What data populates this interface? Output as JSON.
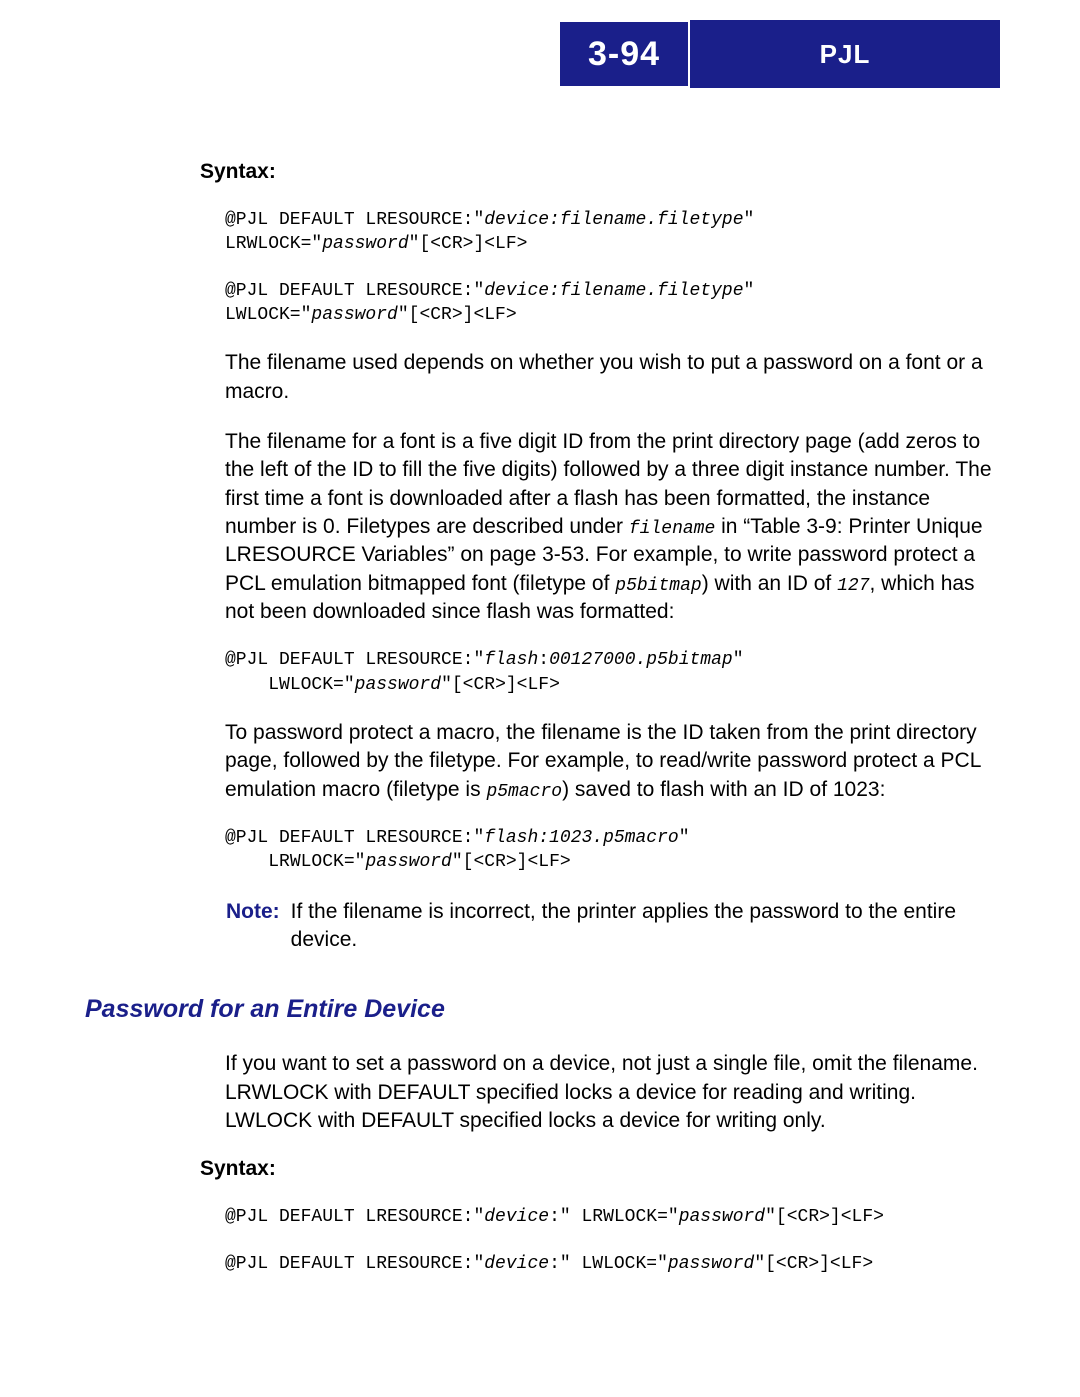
{
  "header": {
    "page_number": "3-94",
    "title": "PJL"
  },
  "section1": {
    "syntax_label": "Syntax:",
    "code1_pre": "@PJL DEFAULT LRESOURCE:\"",
    "code1_i1": "device:filename.filetype",
    "code1_mid": "\"\nLRWLOCK=\"",
    "code1_i2": "password",
    "code1_post": "\"[<CR>]<LF>",
    "code2_pre": "@PJL DEFAULT LRESOURCE:\"",
    "code2_i1": "device:filename.filetype",
    "code2_mid": "\"\nLWLOCK=\"",
    "code2_i2": "password",
    "code2_post": "\"[<CR>]<LF>",
    "para1": "The filename used depends on whether you wish to put a password on a font or a macro.",
    "para2_a": "The filename for a font is a five digit ID from the print directory page (add zeros to the left of the ID to fill the five digits) followed by a three digit instance number. The first time a font is downloaded after a flash has been formatted, the instance number is 0. Filetypes are described under ",
    "para2_m1": "filename",
    "para2_b": " in “Table 3-9: Printer Unique LRESOURCE Variables” on page 3-53. For example, to write password protect a PCL emulation bitmapped font (filetype of ",
    "para2_m2": "p5bitmap",
    "para2_c": ") with an ID of ",
    "para2_m3": "127",
    "para2_d": ", which has not been downloaded since flash was formatted:",
    "code3_pre": "@PJL DEFAULT LRESOURCE:\"",
    "code3_i1": "flash",
    "code3_mid1": ":",
    "code3_i2": "00127000.p5bitmap",
    "code3_mid2": "\"\n    LWLOCK=\"",
    "code3_i3": "password",
    "code3_post": "\"[<CR>]<LF>",
    "para3_a": "To password protect a macro, the filename is the ID taken from the print directory page, followed by the filetype. For example, to read/write password protect a PCL emulation macro (filetype is ",
    "para3_m1": "p5macro",
    "para3_b": ") saved to flash with an ID of 1023:",
    "code4_pre": "@PJL DEFAULT LRESOURCE:\"",
    "code4_i1": "flash:1023.p5macro",
    "code4_mid": "\"\n    LRWLOCK=\"",
    "code4_i2": "password",
    "code4_post": "\"[<CR>]<LF>",
    "note_label": "Note:",
    "note_text": "If the filename is incorrect, the printer applies the password to the entire device."
  },
  "section2": {
    "heading": "Password for an Entire Device",
    "para1": "If you want to set a password on a device, not just a single file, omit the filename. LRWLOCK with DEFAULT specified locks a device for reading and writing. LWLOCK with DEFAULT specified locks a device for writing only.",
    "syntax_label": "Syntax:",
    "code1_pre": "@PJL DEFAULT LRESOURCE:\"",
    "code1_i1": "device",
    "code1_mid": ":\" LRWLOCK=\"",
    "code1_i2": "password",
    "code1_post": "\"[<CR>]<LF>",
    "code2_pre": "@PJL DEFAULT LRESOURCE:\"",
    "code2_i1": "device",
    "code2_mid": ":\" LWLOCK=\"",
    "code2_i2": "password",
    "code2_post": "\"[<CR>]<LF>"
  }
}
